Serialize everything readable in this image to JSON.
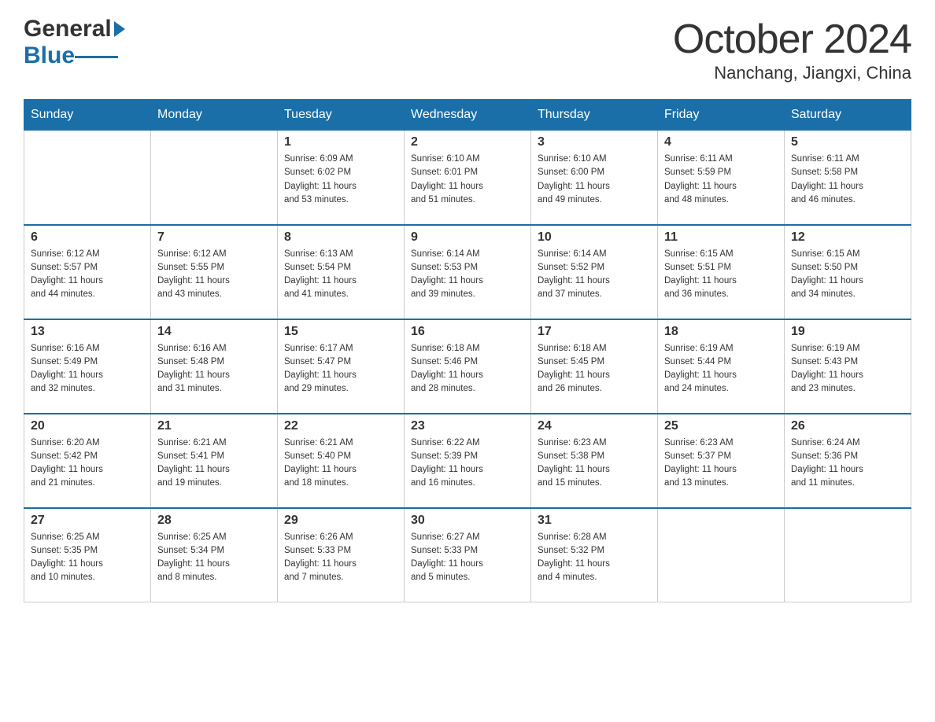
{
  "header": {
    "month_year": "October 2024",
    "location": "Nanchang, Jiangxi, China",
    "logo_general": "General",
    "logo_blue": "Blue"
  },
  "weekdays": [
    "Sunday",
    "Monday",
    "Tuesday",
    "Wednesday",
    "Thursday",
    "Friday",
    "Saturday"
  ],
  "weeks": [
    [
      {
        "day": "",
        "info": ""
      },
      {
        "day": "",
        "info": ""
      },
      {
        "day": "1",
        "info": "Sunrise: 6:09 AM\nSunset: 6:02 PM\nDaylight: 11 hours\nand 53 minutes."
      },
      {
        "day": "2",
        "info": "Sunrise: 6:10 AM\nSunset: 6:01 PM\nDaylight: 11 hours\nand 51 minutes."
      },
      {
        "day": "3",
        "info": "Sunrise: 6:10 AM\nSunset: 6:00 PM\nDaylight: 11 hours\nand 49 minutes."
      },
      {
        "day": "4",
        "info": "Sunrise: 6:11 AM\nSunset: 5:59 PM\nDaylight: 11 hours\nand 48 minutes."
      },
      {
        "day": "5",
        "info": "Sunrise: 6:11 AM\nSunset: 5:58 PM\nDaylight: 11 hours\nand 46 minutes."
      }
    ],
    [
      {
        "day": "6",
        "info": "Sunrise: 6:12 AM\nSunset: 5:57 PM\nDaylight: 11 hours\nand 44 minutes."
      },
      {
        "day": "7",
        "info": "Sunrise: 6:12 AM\nSunset: 5:55 PM\nDaylight: 11 hours\nand 43 minutes."
      },
      {
        "day": "8",
        "info": "Sunrise: 6:13 AM\nSunset: 5:54 PM\nDaylight: 11 hours\nand 41 minutes."
      },
      {
        "day": "9",
        "info": "Sunrise: 6:14 AM\nSunset: 5:53 PM\nDaylight: 11 hours\nand 39 minutes."
      },
      {
        "day": "10",
        "info": "Sunrise: 6:14 AM\nSunset: 5:52 PM\nDaylight: 11 hours\nand 37 minutes."
      },
      {
        "day": "11",
        "info": "Sunrise: 6:15 AM\nSunset: 5:51 PM\nDaylight: 11 hours\nand 36 minutes."
      },
      {
        "day": "12",
        "info": "Sunrise: 6:15 AM\nSunset: 5:50 PM\nDaylight: 11 hours\nand 34 minutes."
      }
    ],
    [
      {
        "day": "13",
        "info": "Sunrise: 6:16 AM\nSunset: 5:49 PM\nDaylight: 11 hours\nand 32 minutes."
      },
      {
        "day": "14",
        "info": "Sunrise: 6:16 AM\nSunset: 5:48 PM\nDaylight: 11 hours\nand 31 minutes."
      },
      {
        "day": "15",
        "info": "Sunrise: 6:17 AM\nSunset: 5:47 PM\nDaylight: 11 hours\nand 29 minutes."
      },
      {
        "day": "16",
        "info": "Sunrise: 6:18 AM\nSunset: 5:46 PM\nDaylight: 11 hours\nand 28 minutes."
      },
      {
        "day": "17",
        "info": "Sunrise: 6:18 AM\nSunset: 5:45 PM\nDaylight: 11 hours\nand 26 minutes."
      },
      {
        "day": "18",
        "info": "Sunrise: 6:19 AM\nSunset: 5:44 PM\nDaylight: 11 hours\nand 24 minutes."
      },
      {
        "day": "19",
        "info": "Sunrise: 6:19 AM\nSunset: 5:43 PM\nDaylight: 11 hours\nand 23 minutes."
      }
    ],
    [
      {
        "day": "20",
        "info": "Sunrise: 6:20 AM\nSunset: 5:42 PM\nDaylight: 11 hours\nand 21 minutes."
      },
      {
        "day": "21",
        "info": "Sunrise: 6:21 AM\nSunset: 5:41 PM\nDaylight: 11 hours\nand 19 minutes."
      },
      {
        "day": "22",
        "info": "Sunrise: 6:21 AM\nSunset: 5:40 PM\nDaylight: 11 hours\nand 18 minutes."
      },
      {
        "day": "23",
        "info": "Sunrise: 6:22 AM\nSunset: 5:39 PM\nDaylight: 11 hours\nand 16 minutes."
      },
      {
        "day": "24",
        "info": "Sunrise: 6:23 AM\nSunset: 5:38 PM\nDaylight: 11 hours\nand 15 minutes."
      },
      {
        "day": "25",
        "info": "Sunrise: 6:23 AM\nSunset: 5:37 PM\nDaylight: 11 hours\nand 13 minutes."
      },
      {
        "day": "26",
        "info": "Sunrise: 6:24 AM\nSunset: 5:36 PM\nDaylight: 11 hours\nand 11 minutes."
      }
    ],
    [
      {
        "day": "27",
        "info": "Sunrise: 6:25 AM\nSunset: 5:35 PM\nDaylight: 11 hours\nand 10 minutes."
      },
      {
        "day": "28",
        "info": "Sunrise: 6:25 AM\nSunset: 5:34 PM\nDaylight: 11 hours\nand 8 minutes."
      },
      {
        "day": "29",
        "info": "Sunrise: 6:26 AM\nSunset: 5:33 PM\nDaylight: 11 hours\nand 7 minutes."
      },
      {
        "day": "30",
        "info": "Sunrise: 6:27 AM\nSunset: 5:33 PM\nDaylight: 11 hours\nand 5 minutes."
      },
      {
        "day": "31",
        "info": "Sunrise: 6:28 AM\nSunset: 5:32 PM\nDaylight: 11 hours\nand 4 minutes."
      },
      {
        "day": "",
        "info": ""
      },
      {
        "day": "",
        "info": ""
      }
    ]
  ]
}
